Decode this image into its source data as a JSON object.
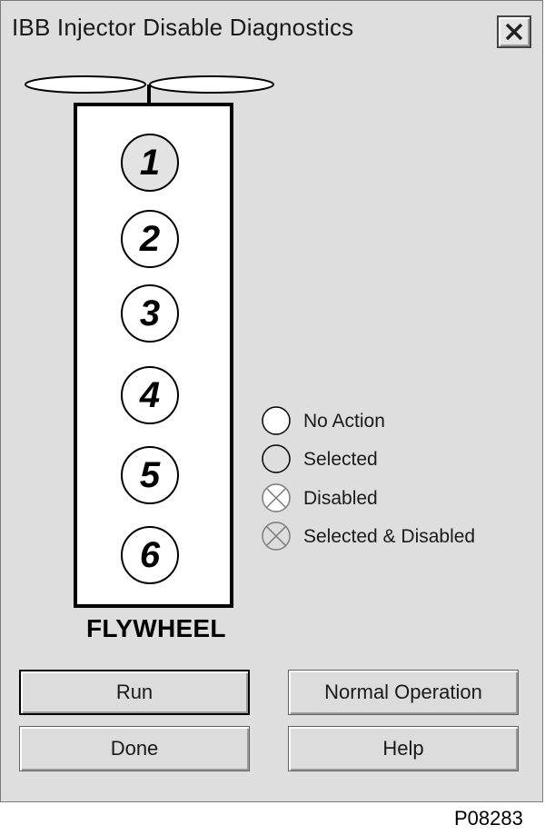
{
  "window": {
    "title": "IBB Injector Disable Diagnostics"
  },
  "engine": {
    "cylinders": [
      {
        "label": "1",
        "state": "Selected"
      },
      {
        "label": "2",
        "state": "No Action"
      },
      {
        "label": "3",
        "state": "No Action"
      },
      {
        "label": "4",
        "state": "No Action"
      },
      {
        "label": "5",
        "state": "No Action"
      },
      {
        "label": "6",
        "state": "No Action"
      }
    ],
    "flywheel_label": "FLYWHEEL"
  },
  "legend": {
    "items": [
      {
        "label": "No Action",
        "icon": "circle-icon"
      },
      {
        "label": "Selected",
        "icon": "circle-icon"
      },
      {
        "label": "Disabled",
        "icon": "circle-x-icon"
      },
      {
        "label": "Selected & Disabled",
        "icon": "circle-x-icon"
      }
    ]
  },
  "buttons": {
    "run": "Run",
    "normal_operation": "Normal Operation",
    "done": "Done",
    "help": "Help"
  },
  "figure_id": "P08283",
  "colors": {
    "dialog_background": "#dedede",
    "selected_fill": "#e3e3e3"
  }
}
